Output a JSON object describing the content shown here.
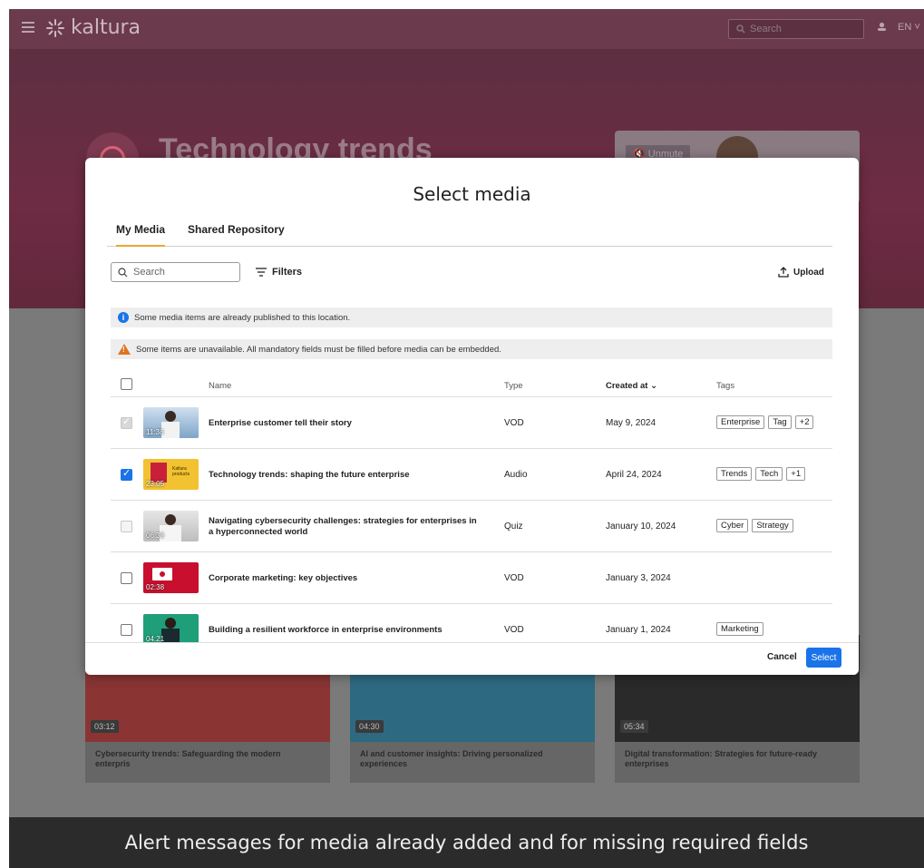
{
  "header": {
    "logo_text": "kaltura",
    "search_placeholder": "Search",
    "language": "EN"
  },
  "hero": {
    "title": "Technology trends",
    "unmute_label": "Unmute"
  },
  "cards": [
    {
      "duration": "03:12",
      "title": "Cybersecurity trends: Safeguarding the modern enterpris"
    },
    {
      "duration": "04:30",
      "title": "AI and customer insights: Driving personalized experiences"
    },
    {
      "duration": "05:34",
      "title": "Digital transformation: Strategies for future-ready enterprises"
    }
  ],
  "modal": {
    "title": "Select media",
    "tabs": [
      {
        "label": "My Media",
        "active": true
      },
      {
        "label": "Shared Repository",
        "active": false
      }
    ],
    "search_placeholder": "Search",
    "filters_label": "Filters",
    "upload_label": "Upload",
    "alerts": {
      "info": "Some media items are already published to this location.",
      "warning": "Some items are unavailable. All mandatory fields must be filled before media can be embedded."
    },
    "columns": {
      "name": "Name",
      "type": "Type",
      "created": "Created at",
      "tags": "Tags"
    },
    "rows": [
      {
        "name": "Enterprise customer tell their story",
        "type": "VOD",
        "created": "May 9, 2024",
        "duration": "11:38",
        "tags": [
          "Enterprise",
          "Tag",
          "+2"
        ],
        "state": "published"
      },
      {
        "name": "Technology trends: shaping the future enterprise",
        "type": "Audio",
        "created": "April 24, 2024",
        "duration": "23:05",
        "tags": [
          "Trends",
          "Tech",
          "+1"
        ],
        "state": "checked"
      },
      {
        "name": "Navigating cybersecurity challenges: strategies for enterprises in a hyperconnected world",
        "type": "Quiz",
        "created": "January 10, 2024",
        "duration": "06:38",
        "tags": [
          "Cyber",
          "Strategy"
        ],
        "state": "disabled"
      },
      {
        "name": "Corporate marketing: key objectives",
        "type": "VOD",
        "created": "January 3, 2024",
        "duration": "02:38",
        "tags": [],
        "state": "unchecked"
      },
      {
        "name": "Building a resilient workforce in enterprise environments",
        "type": "VOD",
        "created": "January 1, 2024",
        "duration": "04:21",
        "tags": [
          "Marketing"
        ],
        "state": "unchecked"
      }
    ],
    "cancel_label": "Cancel",
    "select_label": "Select"
  },
  "caption": "Alert messages for media already added and for missing required fields",
  "colors": {
    "accent": "#1a73e8",
    "tab_underline": "#e8a733",
    "warning": "#e0731e"
  }
}
